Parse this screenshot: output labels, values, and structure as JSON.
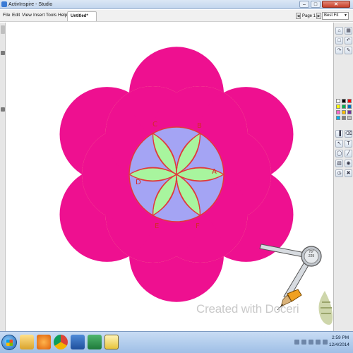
{
  "window": {
    "title": "ActivInspire - Studio",
    "minimize_glyph": "–",
    "maximize_glyph": "□",
    "close_glyph": "✕"
  },
  "menu": {
    "items": [
      "File",
      "Edit",
      "View",
      "Insert",
      "Tools",
      "Help"
    ],
    "document_tab": "Untitled*",
    "page_indicator": "Page 1 of 1",
    "zoom": "Best Fit"
  },
  "drawing": {
    "point_labels": [
      "C",
      "B",
      "A",
      "D",
      "E",
      "F"
    ],
    "colors": {
      "outer_petals": "#ee1090",
      "middle_petals": "#ffff88",
      "center_circle": "#a4a4f4",
      "inner_petals": "#a8f59e",
      "construction_lines": "#e03a3a"
    }
  },
  "compass": {
    "readout_line1": "78°",
    "readout_line2": "229"
  },
  "watermark": {
    "text": "Created with Doceri"
  },
  "toolbox": {
    "swatch_colors": [
      "#ffffff",
      "#000000",
      "#ff0000",
      "#ffff00",
      "#00b050",
      "#0070c0",
      "#ff66cc",
      "#ffc000",
      "#7030a0",
      "#00b0f0",
      "#808080",
      "#c0c0c0"
    ],
    "icons": [
      "home-icon",
      "browser-icon",
      "page-icon",
      "undo-icon",
      "redo-icon",
      "pen-icon",
      "highlighter-icon",
      "eraser-icon",
      "select-icon",
      "text-icon",
      "shape-icon",
      "connector-icon",
      "fill-icon",
      "camera-icon",
      "clock-icon",
      "trash-icon"
    ]
  },
  "taskbar": {
    "time": "2:59 PM",
    "date": "12/4/2014",
    "apps": [
      "folder-icon",
      "media-player-icon",
      "chrome-icon",
      "word-icon",
      "excel-icon",
      "activinspire-icon"
    ]
  }
}
